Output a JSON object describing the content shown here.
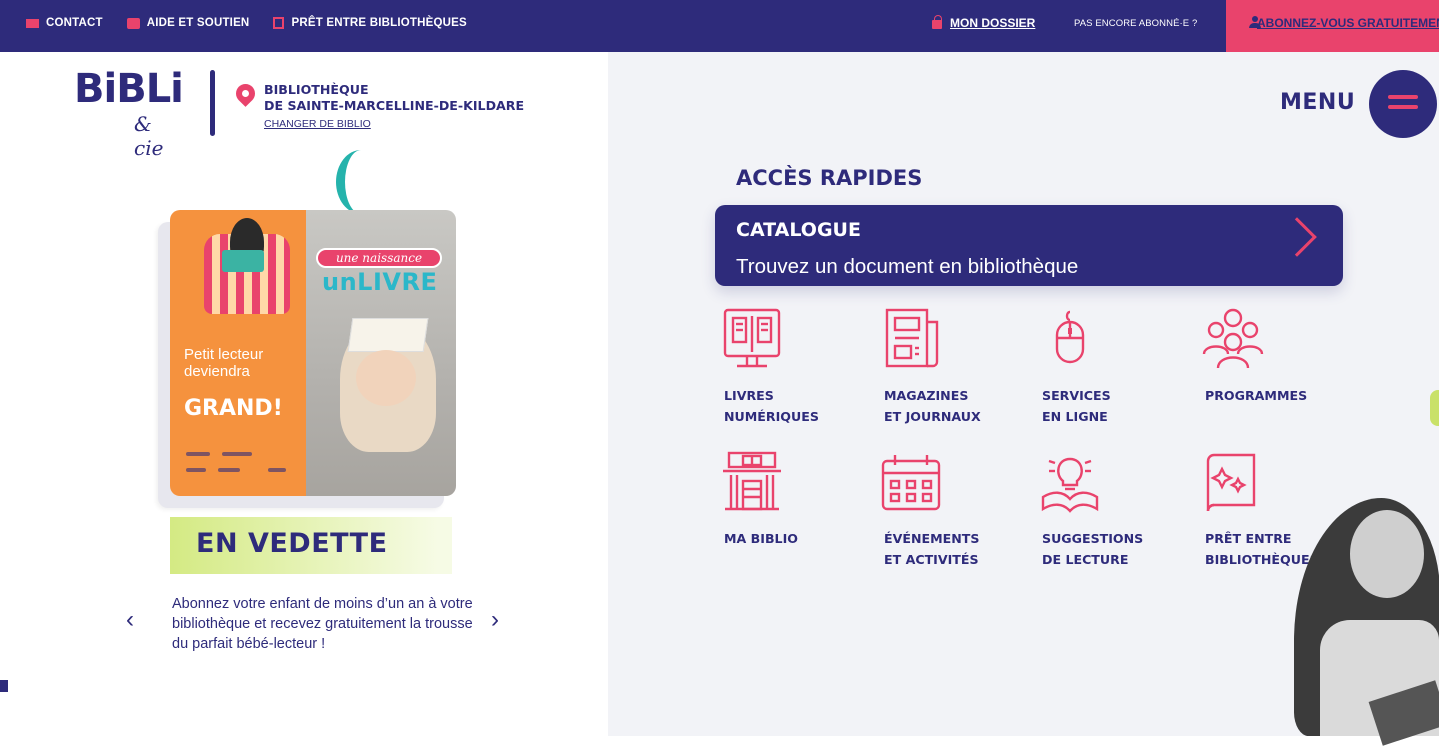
{
  "topbar": {
    "contact": "CONTACT",
    "aide": "AIDE ET SOUTIEN",
    "pret": "PRÊT ENTRE BIBLIOTHÈQUES",
    "dossier": "MON DOSSIER",
    "pas_encore": "PAS ENCORE ABONNÉ·E ?",
    "abonnez": "ABONNEZ-VOUS GRATUITEMENT"
  },
  "logo": {
    "bibli": "BiBLi",
    "cie": "& cie"
  },
  "library": {
    "line1": "BIBLIOTHÈQUE",
    "line2": "DE SAINTE-MARCELLINE-DE-KILDARE",
    "change": "CHANGER DE BIBLIO"
  },
  "menu": {
    "label": "MENU"
  },
  "vedette": {
    "card": {
      "une_naissance": "une naissance",
      "un_livre": "unLIVRE",
      "petit": "Petit lecteur",
      "deviendra": "deviendra",
      "grand": "GRAND!"
    },
    "title": "EN VEDETTE",
    "text": "Abonnez votre enfant de moins d’un an à votre bibliothèque et recevez gratuitement la trousse du parfait bébé-lecteur !",
    "prev": "‹",
    "next": "›"
  },
  "acces": {
    "title": "ACCÈS RAPIDES",
    "catalogue": {
      "title": "CATALOGUE",
      "subtitle": "Trouvez un document en bibliothèque"
    },
    "items": [
      {
        "label": "LIVRES\nNUMÉRIQUES",
        "icon": "ebook-icon"
      },
      {
        "label": "MAGAZINES\nET JOURNAUX",
        "icon": "newspaper-icon"
      },
      {
        "label": "SERVICES\nEN LIGNE",
        "icon": "mouse-icon"
      },
      {
        "label": "PROGRAMMES",
        "icon": "people-icon"
      },
      {
        "label": "MA BIBLIO",
        "icon": "library-building-icon"
      },
      {
        "label": "ÉVÉNEMENTS\nET ACTIVITÉS",
        "icon": "calendar-icon"
      },
      {
        "label": "SUGGESTIONS\nDE LECTURE",
        "icon": "lightbulb-book-icon"
      },
      {
        "label": "PRÊT ENTRE\nBIBLIOTHÈQUES",
        "icon": "sparkle-book-icon"
      }
    ]
  },
  "colors": {
    "navy": "#2e2b7b",
    "pink": "#e9436c",
    "teal": "#25b3ac",
    "lime": "#d4ea83",
    "panel": "#f2f3f7"
  }
}
